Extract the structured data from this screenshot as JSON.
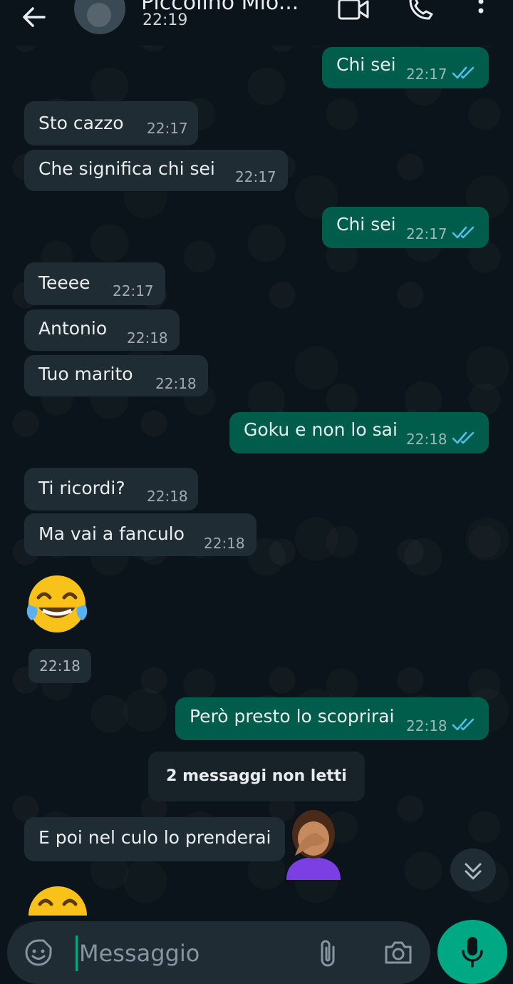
{
  "header": {
    "contact_name": "Piccolino Mio...",
    "last_seen": "22:19"
  },
  "messages": [
    {
      "text": "Chi sei",
      "time": "22:17",
      "dir": "out"
    },
    {
      "text": "Sto cazzo",
      "time": "22:17",
      "dir": "in"
    },
    {
      "text": "Che significa chi sei",
      "time": "22:17",
      "dir": "in"
    },
    {
      "text": "Chi sei",
      "time": "22:17",
      "dir": "out"
    },
    {
      "text": "Teeee",
      "time": "22:17",
      "dir": "in"
    },
    {
      "text": "Antonio",
      "time": "22:18",
      "dir": "in"
    },
    {
      "text": "Tuo marito",
      "time": "22:18",
      "dir": "in"
    },
    {
      "text": "Goku e non lo sai",
      "time": "22:18",
      "dir": "out"
    },
    {
      "text": "Ti ricordi?",
      "time": "22:18",
      "dir": "in"
    },
    {
      "text": "Ma vai a fanculo",
      "time": "22:18",
      "dir": "in"
    },
    {
      "text": "😂",
      "time": "22:18",
      "dir": "in"
    },
    {
      "text": "Però presto lo scoprirai",
      "time": "22:18",
      "dir": "out"
    },
    {
      "text": "E poi nel culo lo prenderai",
      "time": "",
      "dir": "in"
    },
    {
      "text": "🤦🏽‍♀️",
      "time": "",
      "dir": "in"
    },
    {
      "text": "😂",
      "time": "",
      "dir": "in"
    }
  ],
  "unread_banner": "2 messaggi non letti",
  "composer": {
    "placeholder": "Messaggio"
  },
  "icons": {
    "back": "arrow-left-icon",
    "video": "video-call-icon",
    "call": "phone-icon",
    "more": "more-vertical-icon",
    "sticker": "sticker-icon",
    "attach": "paperclip-icon",
    "camera": "camera-icon",
    "mic": "microphone-icon",
    "scroll": "chevrons-down-icon"
  },
  "colors": {
    "outgoing": "#005c4b",
    "incoming": "#202c33",
    "accent": "#00a884",
    "read_ticks": "#53bdeb"
  }
}
